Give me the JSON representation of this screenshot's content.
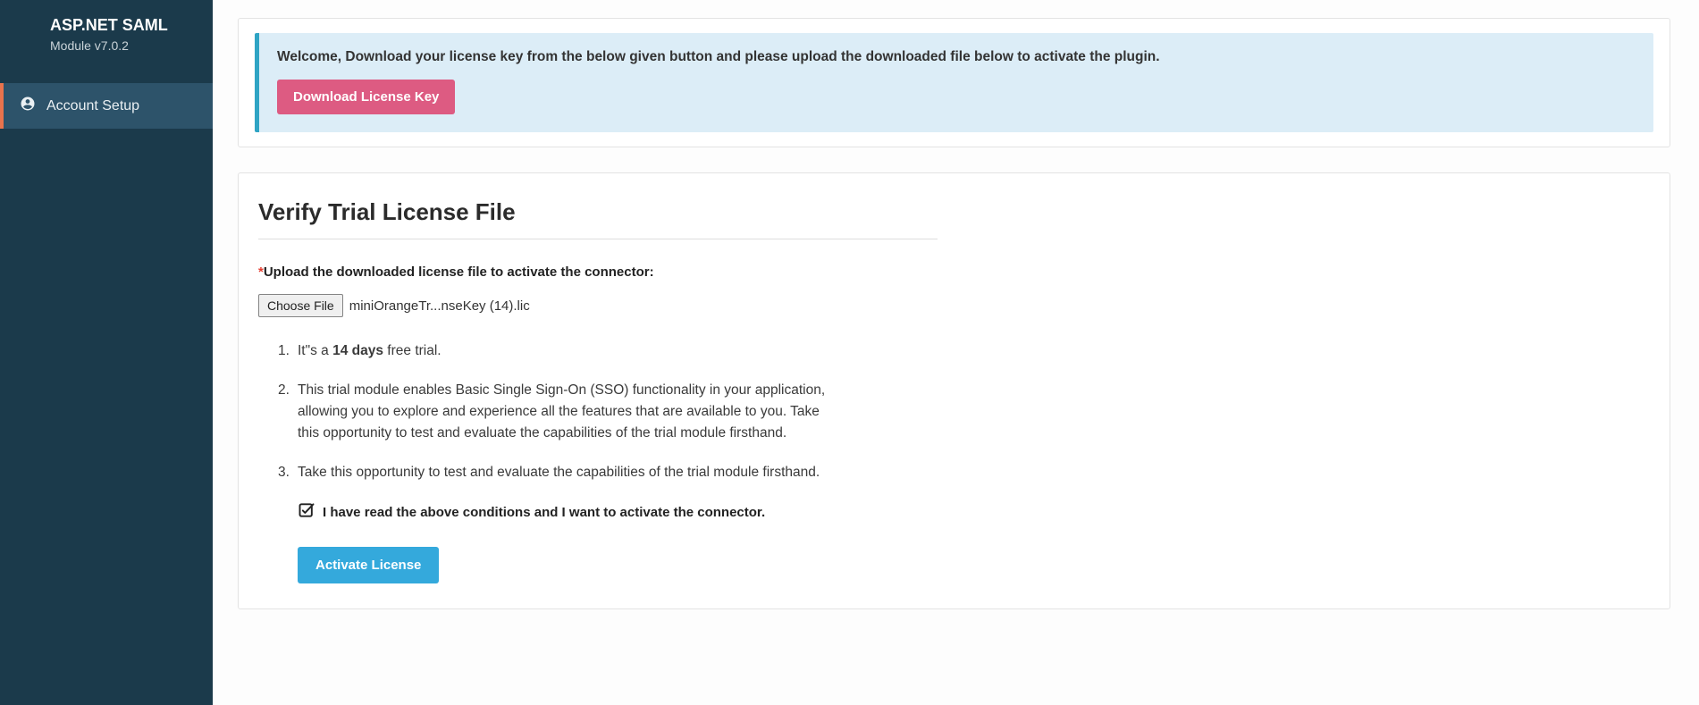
{
  "sidebar": {
    "title": "ASP.NET SAML",
    "subtitle": "Module v7.0.2",
    "items": [
      {
        "icon": "user-circle-icon",
        "label": "Account Setup"
      }
    ]
  },
  "banner": {
    "text": "Welcome, Download your license key from the below given button and please upload the downloaded file below to activate the plugin.",
    "button": "Download License Key"
  },
  "verify": {
    "title": "Verify Trial License File",
    "upload_label": "Upload the downloaded license file to activate the connector:",
    "choose_button": "Choose File",
    "file_name": "miniOrangeTr...nseKey (14).lic",
    "notes": {
      "n1_pre": "1.",
      "n1_a": "It\"s a ",
      "n1_b": "14 days",
      "n1_c": " free trial.",
      "n2_pre": "2.",
      "n2": "This trial module enables Basic Single Sign-On (SSO) functionality in your application, allowing you to explore and experience all the features that are available to you. Take this opportunity to test and evaluate the capabilities of the trial module firsthand.",
      "n3_pre": "3.",
      "n3": "Take this opportunity to test and evaluate the capabilities of the trial module firsthand."
    },
    "consent_label": "I have read the above conditions and I want to activate the connector.",
    "activate_button": "Activate License"
  }
}
